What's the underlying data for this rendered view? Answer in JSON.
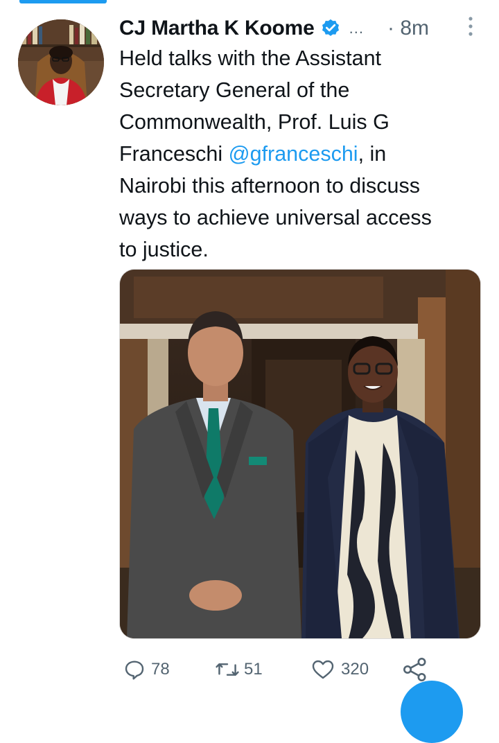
{
  "tweet": {
    "author_name": "CJ Martha K Koome",
    "more_label": "...",
    "time": "· 8m",
    "text_before_mention": "Held talks with the Assistant\nSecretary General of the\nCommonwealth, Prof. Luis G\nFranceschi ",
    "mention": "@gfranceschi",
    "text_after_mention": ", in\nNairobi this afternoon to discuss\nways to achieve universal access\nto justice."
  },
  "actions": {
    "replies": "78",
    "retweets": "51",
    "likes": "320"
  },
  "icons": {
    "verified": "verified-badge-icon",
    "more": "more-vertical-icon",
    "reply": "reply-icon",
    "retweet": "retweet-icon",
    "like": "heart-icon",
    "share": "share-icon"
  },
  "colors": {
    "accent": "#1d9bf0",
    "text": "#0f1419",
    "muted": "#536471"
  }
}
